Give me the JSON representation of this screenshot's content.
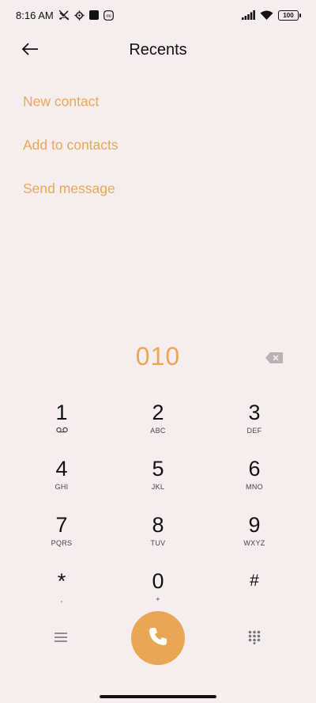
{
  "status_bar": {
    "time": "8:16 AM",
    "battery": "100",
    "icons": [
      "missed-call-icon",
      "settings-gear-icon",
      "square-app-icon",
      "mi-icon",
      "signal-icon",
      "wifi-icon",
      "battery-icon"
    ]
  },
  "header": {
    "title": "Recents",
    "back_icon": "back-arrow-icon"
  },
  "options": [
    {
      "label": "New contact"
    },
    {
      "label": "Add to contacts"
    },
    {
      "label": "Send message"
    }
  ],
  "dialer": {
    "number": "010",
    "backspace_icon": "backspace-icon"
  },
  "keypad": {
    "keys": [
      {
        "digit": "1",
        "letters": ""
      },
      {
        "digit": "2",
        "letters": "ABC"
      },
      {
        "digit": "3",
        "letters": "DEF"
      },
      {
        "digit": "4",
        "letters": "GHI"
      },
      {
        "digit": "5",
        "letters": "JKL"
      },
      {
        "digit": "6",
        "letters": "MNO"
      },
      {
        "digit": "7",
        "letters": "PQRS"
      },
      {
        "digit": "8",
        "letters": "TUV"
      },
      {
        "digit": "9",
        "letters": "WXYZ"
      },
      {
        "digit": "*",
        "letters": ","
      },
      {
        "digit": "0",
        "letters": "+"
      },
      {
        "digit": "#",
        "letters": ""
      }
    ]
  },
  "bottom_bar": {
    "menu_icon": "menu-icon",
    "call_icon": "phone-icon",
    "keypad_icon": "dialpad-icon"
  },
  "colors": {
    "accent": "#e9a756",
    "background": "#f5edee",
    "text": "#111111"
  }
}
